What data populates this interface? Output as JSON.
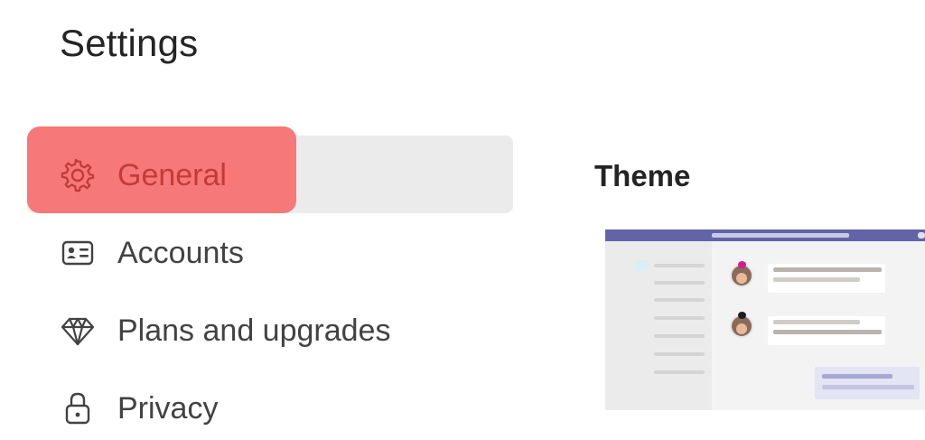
{
  "page": {
    "title": "Settings"
  },
  "nav": {
    "items": [
      {
        "label": "General",
        "icon": "gear-icon",
        "selected": true
      },
      {
        "label": "Accounts",
        "icon": "id-card-icon",
        "selected": false
      },
      {
        "label": "Plans and upgrades",
        "icon": "diamond-icon",
        "selected": false
      },
      {
        "label": "Privacy",
        "icon": "lock-icon",
        "selected": false
      }
    ]
  },
  "content": {
    "section_title": "Theme"
  },
  "colors": {
    "highlight": "#f67878",
    "selected_bg": "#ebebeb",
    "theme_topbar": "#6264a7",
    "text_primary": "#242424",
    "text_secondary": "#424242"
  }
}
